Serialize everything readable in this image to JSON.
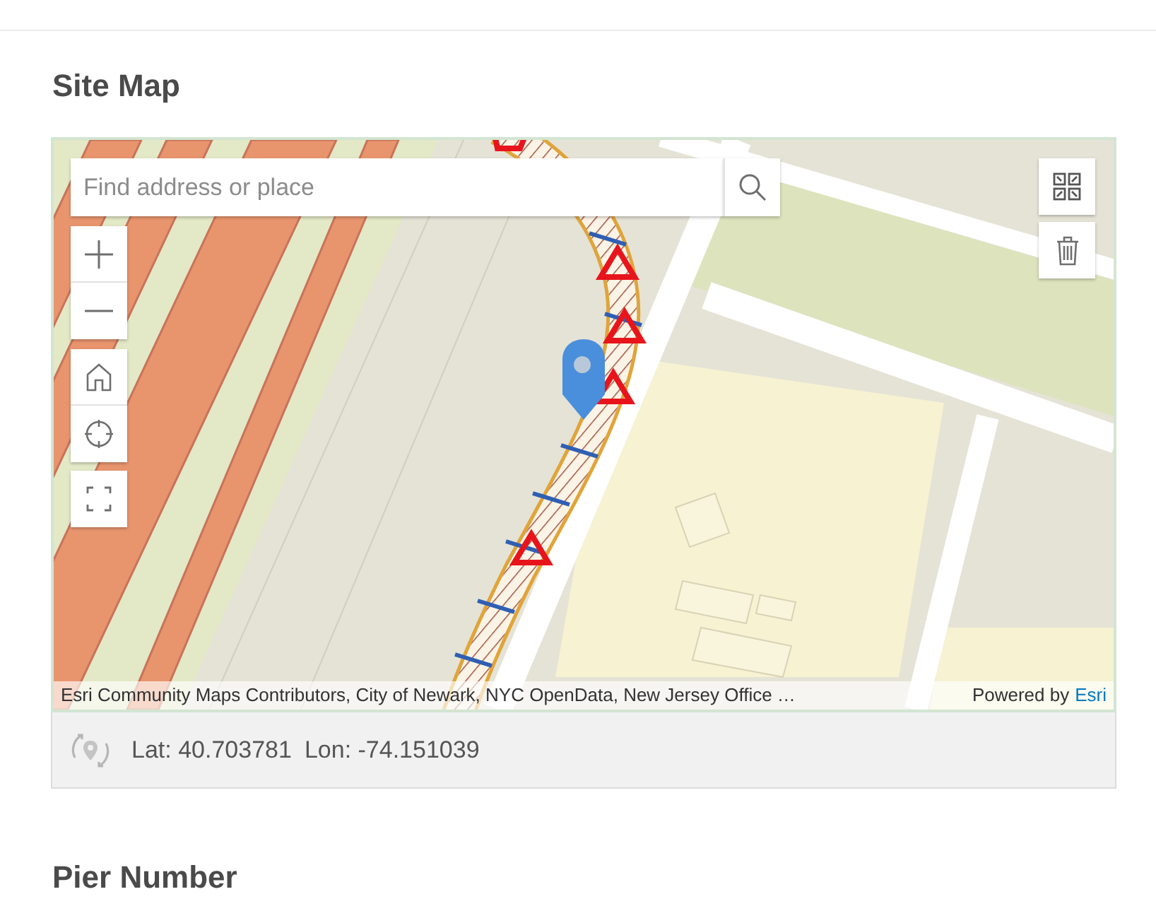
{
  "section": {
    "title": "Site Map"
  },
  "map": {
    "search": {
      "placeholder": "Find address or place"
    },
    "attribution": "Esri Community Maps Contributors, City of Newark, NYC OpenData, New Jersey Office …",
    "powered_by": {
      "label": "Powered by",
      "link": "Esri"
    }
  },
  "location": {
    "lat": "Lat: 40.703781",
    "lon": "Lon: -74.151039"
  },
  "next_section": {
    "title": "Pier Number"
  }
}
